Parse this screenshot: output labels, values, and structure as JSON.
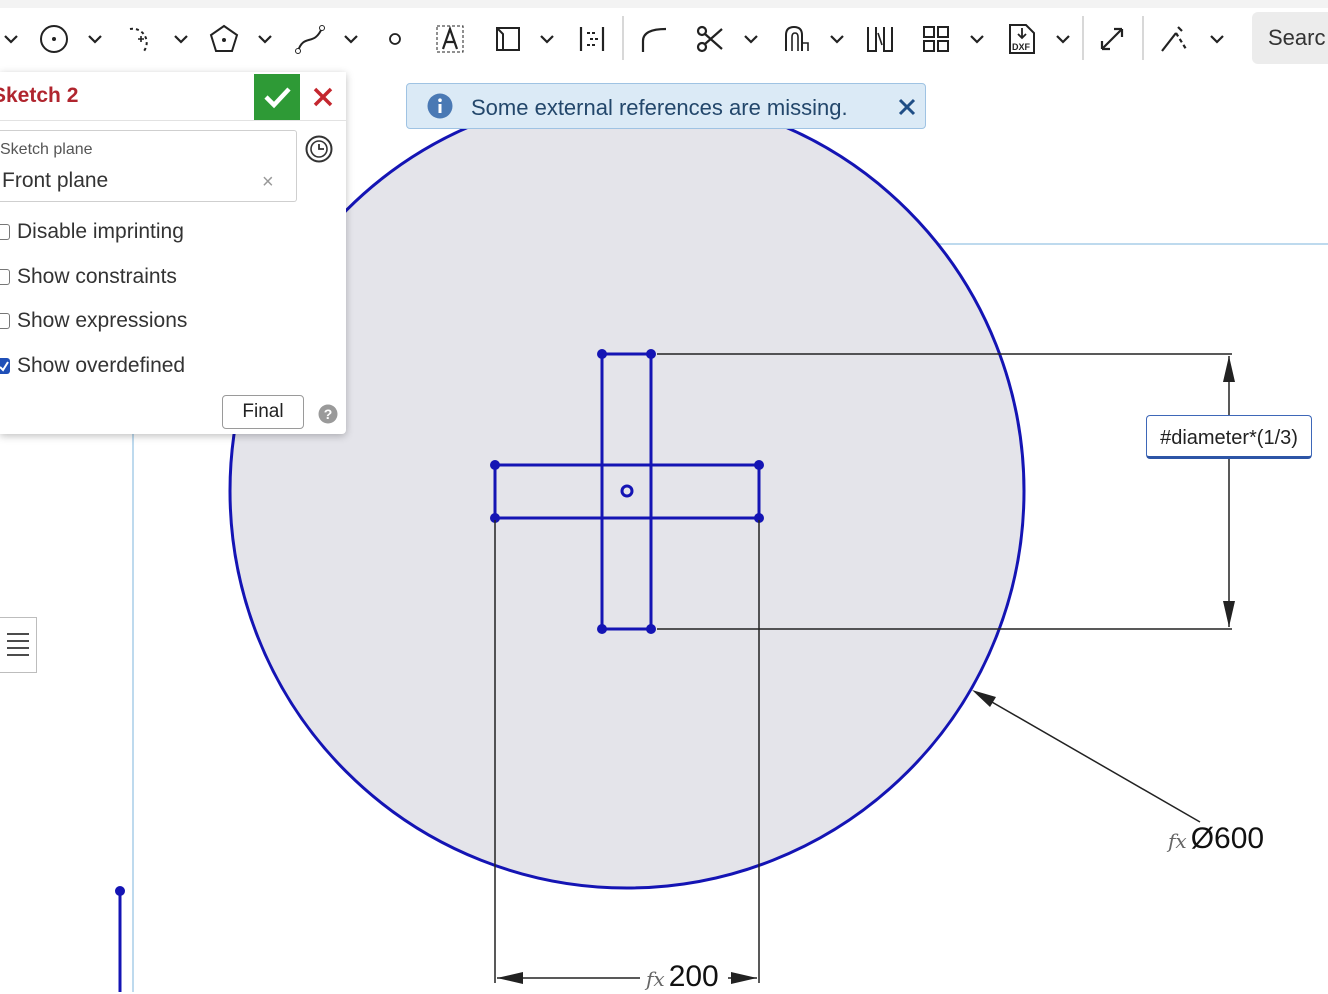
{
  "toolbar": {
    "search_label": "Searc",
    "icons": [
      "chevron-down-icon",
      "circle-icon",
      "center-point-arc-icon",
      "polygon-icon",
      "spline-icon",
      "point-icon",
      "text-icon",
      "use-icon",
      "mirror-icon",
      "fillet-icon",
      "trim-icon",
      "offset-icon",
      "slot-icon",
      "pattern-icon",
      "dxf-import-icon",
      "dimension-icon",
      "construction-icon"
    ]
  },
  "panel": {
    "title": "Sketch 2",
    "sketch_plane_label": "Sketch plane",
    "sketch_plane_value": "Front plane",
    "clear_symbol": "×",
    "options": [
      {
        "label": "Disable imprinting",
        "checked": false
      },
      {
        "label": "Show constraints",
        "checked": false
      },
      {
        "label": "Show expressions",
        "checked": false
      },
      {
        "label": "Show overdefined",
        "checked": true
      }
    ],
    "final_label": "Final"
  },
  "notice": {
    "message": "Some external references are missing."
  },
  "dimensions": {
    "expression_input": "#diameter*(1/3)",
    "diameter": {
      "fx": "fx",
      "value": "Ø600"
    },
    "width": {
      "fx": "fx",
      "value": "200"
    }
  },
  "colors": {
    "sketch_blue": "#1414b4",
    "accept_green": "#2e9a36",
    "cancel_red": "#c4272f",
    "notice_bg": "#dbeaf6"
  }
}
